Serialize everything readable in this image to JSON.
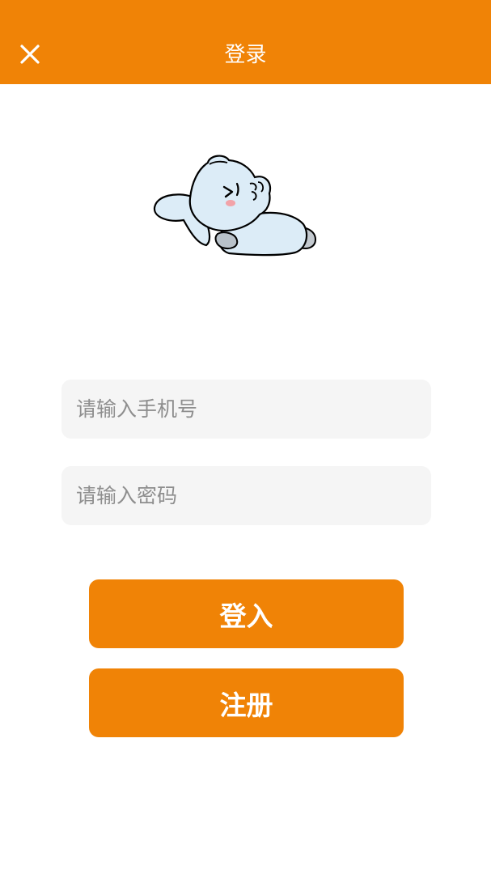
{
  "header": {
    "title": "登录",
    "close_icon": "close-icon",
    "bg_color": "#f08306"
  },
  "mascot": {
    "icon": "sleeping-elephant-icon"
  },
  "form": {
    "phone": {
      "placeholder": "请输入手机号",
      "value": ""
    },
    "password": {
      "placeholder": "请输入密码",
      "value": ""
    }
  },
  "buttons": {
    "login_label": "登入",
    "register_label": "注册",
    "accent_color": "#f08306"
  }
}
